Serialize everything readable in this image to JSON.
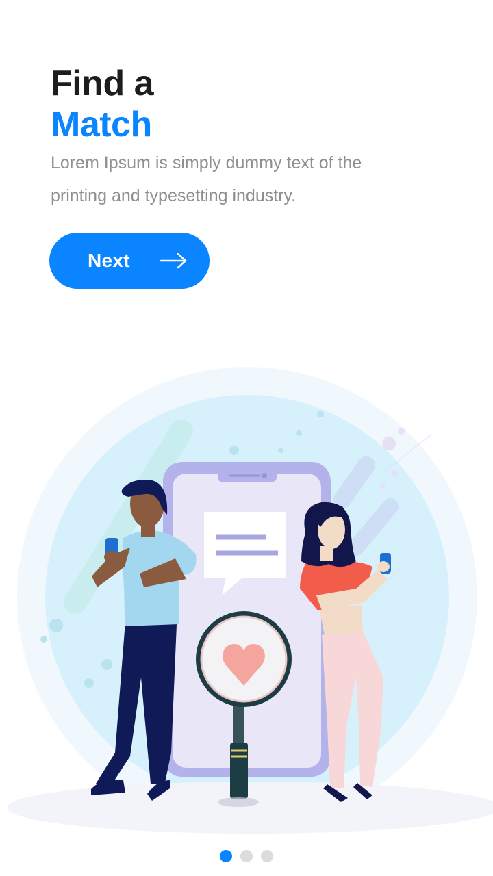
{
  "header": {
    "title_line1": "Find a",
    "title_line2": "Match",
    "subtitle_line1": "Lorem Ipsum is simply dummy text of the",
    "subtitle_line2": "printing and typesetting industry."
  },
  "next_button": {
    "label": "Next",
    "icon": "arrow-right-icon"
  },
  "pagination": {
    "total": 3,
    "active": 1
  },
  "colors": {
    "accent": "#0a84ff",
    "title": "#1d1d1f",
    "subtitle": "#8e8e93",
    "dot_inactive": "#dcdcdc"
  }
}
